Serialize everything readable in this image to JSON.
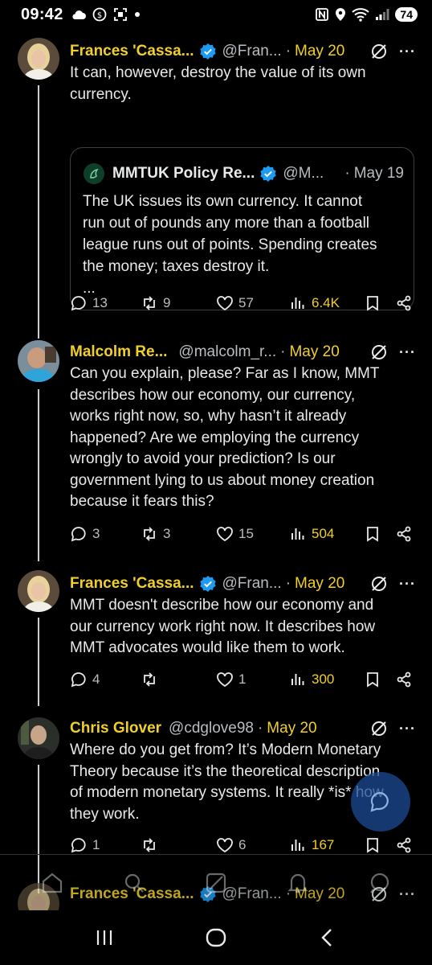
{
  "status_bar": {
    "time": "09:42",
    "battery": "74"
  },
  "tweets": [
    {
      "name": "Frances 'Cassa...",
      "handle": "@Fran...",
      "date": "May 20",
      "text_lines": [
        "It can, however, destroy the value of its own",
        "currency."
      ],
      "quote": {
        "name": "MMTUK Policy Re...",
        "handle": "@M...",
        "date": "May 19",
        "text_lines": [
          "The UK issues its own currency. It cannot",
          "run out of pounds any more than a football",
          "league runs out of points. Spending creates",
          "the money; taxes destroy it.",
          "..."
        ]
      },
      "replies": "13",
      "reposts": "9",
      "likes": "57",
      "views": "6.4K"
    },
    {
      "name": "Malcolm Re...",
      "handle": "@malcolm_r...",
      "date": "May 20",
      "text_lines": [
        "Can you explain, please? Far as I know, MMT",
        "describes how our economy, our currency,",
        "works right now, so, why hasn’t it already",
        "happened? Are we employing the currency",
        "wrongly to avoid your prediction? Is our",
        "government lying to us about money creation",
        "because it fears this?"
      ],
      "replies": "3",
      "reposts": "3",
      "likes": "15",
      "views": "504"
    },
    {
      "name": "Frances 'Cassa...",
      "handle": "@Fran...",
      "date": "May 20",
      "text_lines": [
        "MMT doesn't describe how our economy and",
        "our currency work right now. It describes how",
        "MMT advocates would like them to work."
      ],
      "replies": "4",
      "reposts": "",
      "likes": "1",
      "views": "300"
    },
    {
      "name": "Chris Glover",
      "handle": "@cdglove98",
      "date": "May 20",
      "text_lines": [
        "Where do you get from? It’s Modern Monetary",
        "Theory because it’s the theoretical description",
        "of modern monetary systems. It really *is* how",
        "they work."
      ],
      "replies": "1",
      "reposts": "",
      "likes": "6",
      "views": "167"
    },
    {
      "name": "Frances 'Cassa...",
      "handle": "@Fran...",
      "date": "May 20"
    }
  ],
  "colors": {
    "accent": "#f1cf2b",
    "verified": "#1d9bf0",
    "background": "#000000"
  }
}
